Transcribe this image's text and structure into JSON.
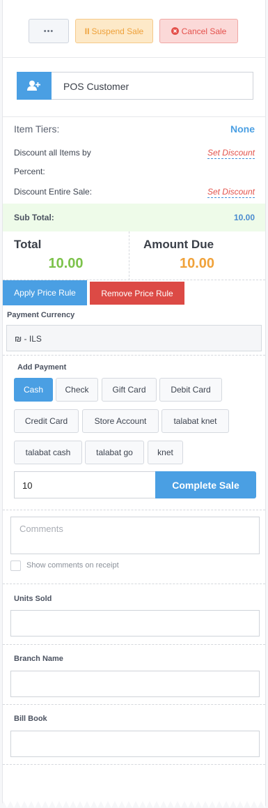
{
  "top_actions": {
    "more_label": "•••",
    "suspend_label": "Suspend Sale",
    "cancel_label": "Cancel Sale"
  },
  "customer": {
    "name": "POS Customer"
  },
  "summary": {
    "item_tiers_label": "Item Tiers:",
    "item_tiers_value": "None",
    "discount_items_label_line1": "Discount all Items by",
    "discount_items_label_line2": "Percent:",
    "set_discount_1": "Set Discount",
    "discount_sale_label": "Discount Entire Sale:",
    "set_discount_2": "Set Discount",
    "subtotal_label": "Sub Total:",
    "subtotal_value": "10.00"
  },
  "totals": {
    "total_label": "Total",
    "total_value": "10.00",
    "amount_due_label": "Amount Due",
    "amount_due_value": "10.00"
  },
  "price_rules": {
    "apply_label": "Apply Price Rule",
    "remove_label": "Remove Price Rule"
  },
  "currency": {
    "label": "Payment Currency",
    "value": "₪ - ILS"
  },
  "payment": {
    "label": "Add Payment",
    "methods_row1": [
      "Cash",
      "Check",
      "Gift Card",
      "Debit Card"
    ],
    "methods_row2": [
      "Credit Card",
      "Store Account",
      "talabat knet"
    ],
    "methods_row3": [
      "talabat cash",
      "talabat go",
      "knet"
    ],
    "amount_value": "10",
    "complete_label": "Complete Sale"
  },
  "comments": {
    "placeholder": "Comments",
    "show_on_receipt_label": "Show comments on receipt"
  },
  "custom_fields": {
    "units_sold_label": "Units Sold",
    "branch_name_label": "Branch Name",
    "bill_book_label": "Bill Book"
  },
  "colors": {
    "primary_blue": "#4a9fe3",
    "danger_red": "#dc4a45",
    "green_value": "#7cc24a",
    "orange_value": "#f0a23a",
    "warning_bg": "#fde9c8"
  }
}
